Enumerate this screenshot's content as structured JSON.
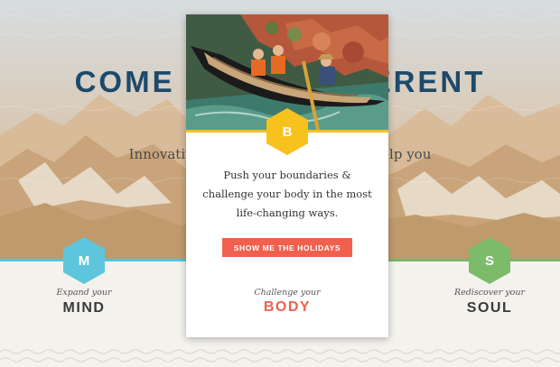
{
  "hero": {
    "title": "COME BACK DIFFERENT",
    "subtitle": "Innovative adventure holidays that help you"
  },
  "pillars": {
    "mind": {
      "letter": "M",
      "kicker": "Expand your",
      "word": "MIND",
      "color": "#5ec6dc"
    },
    "body": {
      "letter": "B",
      "kicker": "Challenge your",
      "word": "BODY",
      "color": "#f7c21d"
    },
    "soul": {
      "letter": "S",
      "kicker": "Rediscover your",
      "word": "SOUL",
      "color": "#7cbb6a"
    }
  },
  "card": {
    "description": "Push your boundaries & challenge your body in the most life-changing ways.",
    "cta_label": "SHOW ME THE HOLIDAYS",
    "accent": "#f1604e",
    "photo_icon": "rafting-photo"
  }
}
